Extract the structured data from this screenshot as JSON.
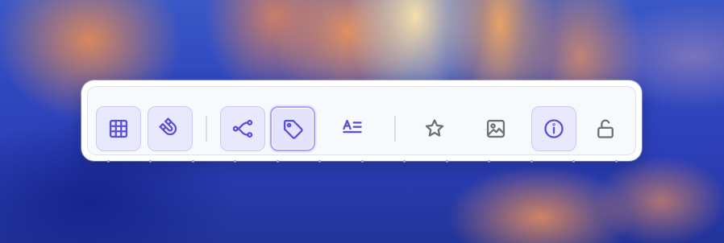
{
  "toolbar": {
    "buttons": [
      {
        "icon": "grid-icon",
        "state": "active"
      },
      {
        "icon": "magnet-icon",
        "state": "active"
      },
      {
        "icon": "connector-icon",
        "state": "active"
      },
      {
        "icon": "tag-icon",
        "state": "selected"
      },
      {
        "icon": "text-align-icon",
        "state": "normal"
      },
      {
        "icon": "star-icon",
        "state": "normal"
      },
      {
        "icon": "image-icon",
        "state": "normal"
      },
      {
        "icon": "info-icon",
        "state": "active"
      },
      {
        "icon": "unlock-icon",
        "state": "normal"
      }
    ]
  },
  "colors": {
    "accent": "#5a52d6",
    "icon_gray": "#6f7278",
    "active_bg": "#e9e9fd",
    "active_border": "#c9c9f7",
    "selected_border": "#a8a6f4",
    "dock_bg": "#f8f9fc"
  }
}
